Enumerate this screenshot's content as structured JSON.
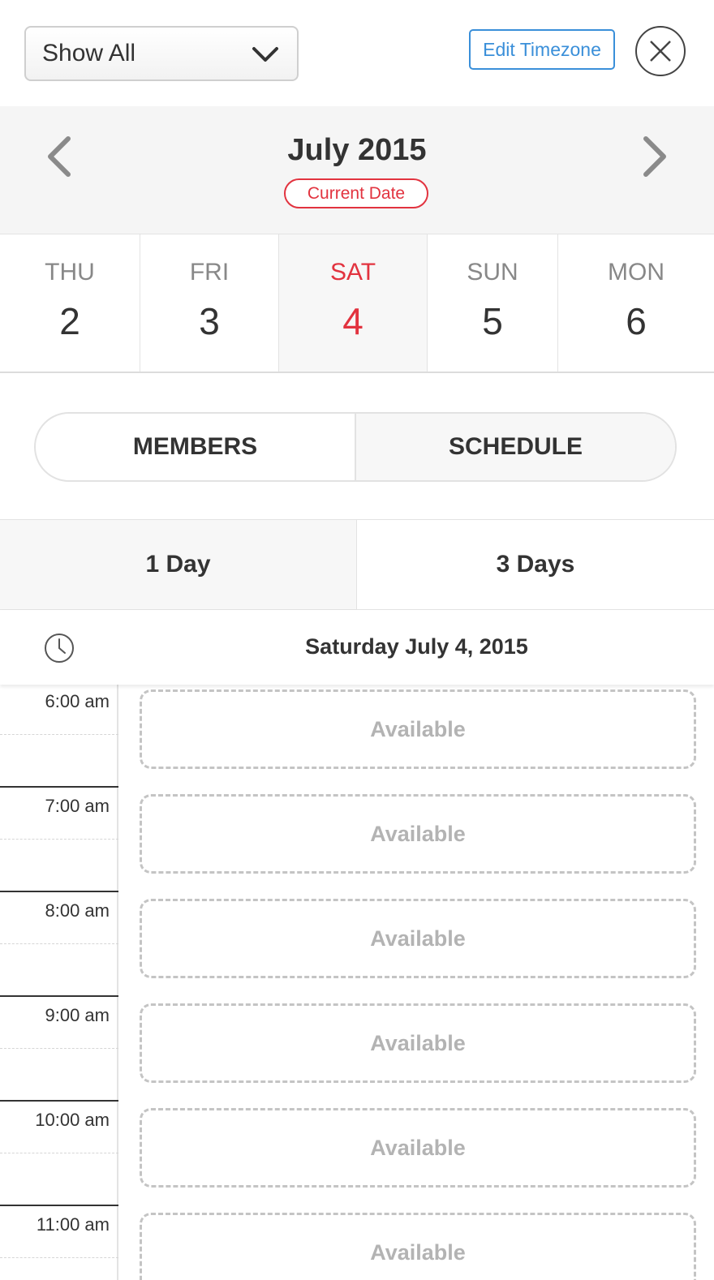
{
  "topbar": {
    "filter_value": "Show All",
    "edit_timezone_label": "Edit Timezone"
  },
  "month": {
    "title": "July 2015",
    "current_date_label": "Current Date"
  },
  "days": [
    {
      "dow": "THU",
      "num": "2"
    },
    {
      "dow": "FRI",
      "num": "3"
    },
    {
      "dow": "SAT",
      "num": "4"
    },
    {
      "dow": "SUN",
      "num": "5"
    },
    {
      "dow": "MON",
      "num": "6"
    }
  ],
  "selected_day_index": 2,
  "segments": {
    "members": "MEMBERS",
    "schedule": "SCHEDULE"
  },
  "range_tabs": {
    "one_day": "1 Day",
    "three_days": "3 Days"
  },
  "date_header": "Saturday July 4, 2015",
  "slots": [
    {
      "time": "6:00 am",
      "status": "Available"
    },
    {
      "time": "7:00 am",
      "status": "Available"
    },
    {
      "time": "8:00 am",
      "status": "Available"
    },
    {
      "time": "9:00 am",
      "status": "Available"
    },
    {
      "time": "10:00 am",
      "status": "Available"
    },
    {
      "time": "11:00 am",
      "status": "Available"
    }
  ],
  "colors": {
    "accent_red": "#e2333f",
    "link_blue": "#3a8fd9"
  },
  "icons": [
    "chevron-down-icon",
    "close-icon",
    "chevron-left-icon",
    "chevron-right-icon",
    "clock-icon"
  ]
}
